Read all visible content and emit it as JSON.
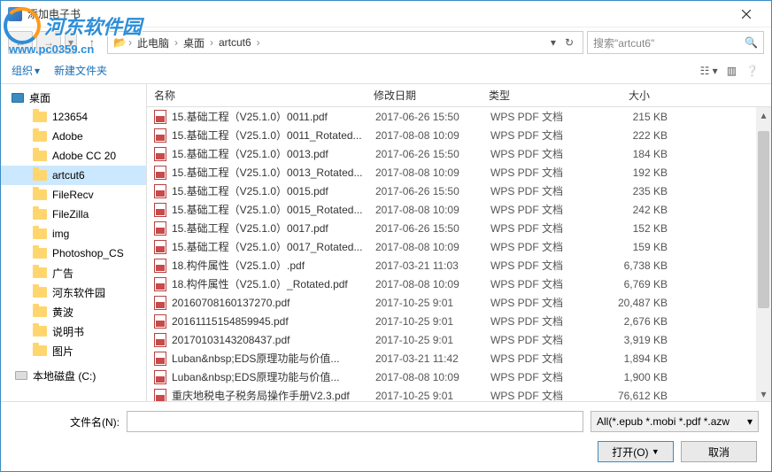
{
  "watermark": {
    "brand": "河东软件园",
    "url": "www.pc0359.cn"
  },
  "title": "添加电子书",
  "breadcrumbs": [
    "此电脑",
    "桌面",
    "artcut6"
  ],
  "search": {
    "placeholder": "搜索\"artcut6\""
  },
  "toolbar": {
    "organize": "组织",
    "newfolder": "新建文件夹"
  },
  "sidebar": {
    "root": "桌面",
    "items": [
      {
        "label": "123654"
      },
      {
        "label": "Adobe"
      },
      {
        "label": "Adobe CC 20"
      },
      {
        "label": "artcut6",
        "selected": true
      },
      {
        "label": "FileRecv"
      },
      {
        "label": "FileZilla"
      },
      {
        "label": "img"
      },
      {
        "label": "Photoshop_CS"
      },
      {
        "label": "广告"
      },
      {
        "label": "河东软件园"
      },
      {
        "label": "黄波"
      },
      {
        "label": "说明书"
      },
      {
        "label": "图片"
      }
    ],
    "drive": "本地磁盘 (C:)"
  },
  "columns": {
    "name": "名称",
    "date": "修改日期",
    "type": "类型",
    "size": "大小"
  },
  "files": [
    {
      "name": "15.基础工程（V25.1.0）0011.pdf",
      "date": "2017-06-26 15:50",
      "type": "WPS PDF 文档",
      "size": "215 KB"
    },
    {
      "name": "15.基础工程（V25.1.0）0011_Rotated...",
      "date": "2017-08-08 10:09",
      "type": "WPS PDF 文档",
      "size": "222 KB"
    },
    {
      "name": "15.基础工程（V25.1.0）0013.pdf",
      "date": "2017-06-26 15:50",
      "type": "WPS PDF 文档",
      "size": "184 KB"
    },
    {
      "name": "15.基础工程（V25.1.0）0013_Rotated...",
      "date": "2017-08-08 10:09",
      "type": "WPS PDF 文档",
      "size": "192 KB"
    },
    {
      "name": "15.基础工程（V25.1.0）0015.pdf",
      "date": "2017-06-26 15:50",
      "type": "WPS PDF 文档",
      "size": "235 KB"
    },
    {
      "name": "15.基础工程（V25.1.0）0015_Rotated...",
      "date": "2017-08-08 10:09",
      "type": "WPS PDF 文档",
      "size": "242 KB"
    },
    {
      "name": "15.基础工程（V25.1.0）0017.pdf",
      "date": "2017-06-26 15:50",
      "type": "WPS PDF 文档",
      "size": "152 KB"
    },
    {
      "name": "15.基础工程（V25.1.0）0017_Rotated...",
      "date": "2017-08-08 10:09",
      "type": "WPS PDF 文档",
      "size": "159 KB"
    },
    {
      "name": "18.构件属性（V25.1.0）.pdf",
      "date": "2017-03-21 11:03",
      "type": "WPS PDF 文档",
      "size": "6,738 KB"
    },
    {
      "name": "18.构件属性（V25.1.0）_Rotated.pdf",
      "date": "2017-08-08 10:09",
      "type": "WPS PDF 文档",
      "size": "6,769 KB"
    },
    {
      "name": "20160708160137270.pdf",
      "date": "2017-10-25 9:01",
      "type": "WPS PDF 文档",
      "size": "20,487 KB"
    },
    {
      "name": "20161115154859945.pdf",
      "date": "2017-10-25 9:01",
      "type": "WPS PDF 文档",
      "size": "2,676 KB"
    },
    {
      "name": "20170103143208437.pdf",
      "date": "2017-10-25 9:01",
      "type": "WPS PDF 文档",
      "size": "3,919 KB"
    },
    {
      "name": "Luban&amp;nbsp;EDS原理功能与价值...",
      "date": "2017-03-21 11:42",
      "type": "WPS PDF 文档",
      "size": "1,894 KB"
    },
    {
      "name": "Luban&amp;nbsp;EDS原理功能与价值...",
      "date": "2017-08-08 10:09",
      "type": "WPS PDF 文档",
      "size": "1,900 KB"
    },
    {
      "name": "重庆地税电子税务局操作手册V2.3.pdf",
      "date": "2017-10-25 9:01",
      "type": "WPS PDF 文档",
      "size": "76,612 KB"
    }
  ],
  "bottom": {
    "filename_label": "文件名(N):",
    "filter": "All(*.epub *.mobi *.pdf *.azw",
    "open": "打开(O)",
    "cancel": "取消"
  }
}
